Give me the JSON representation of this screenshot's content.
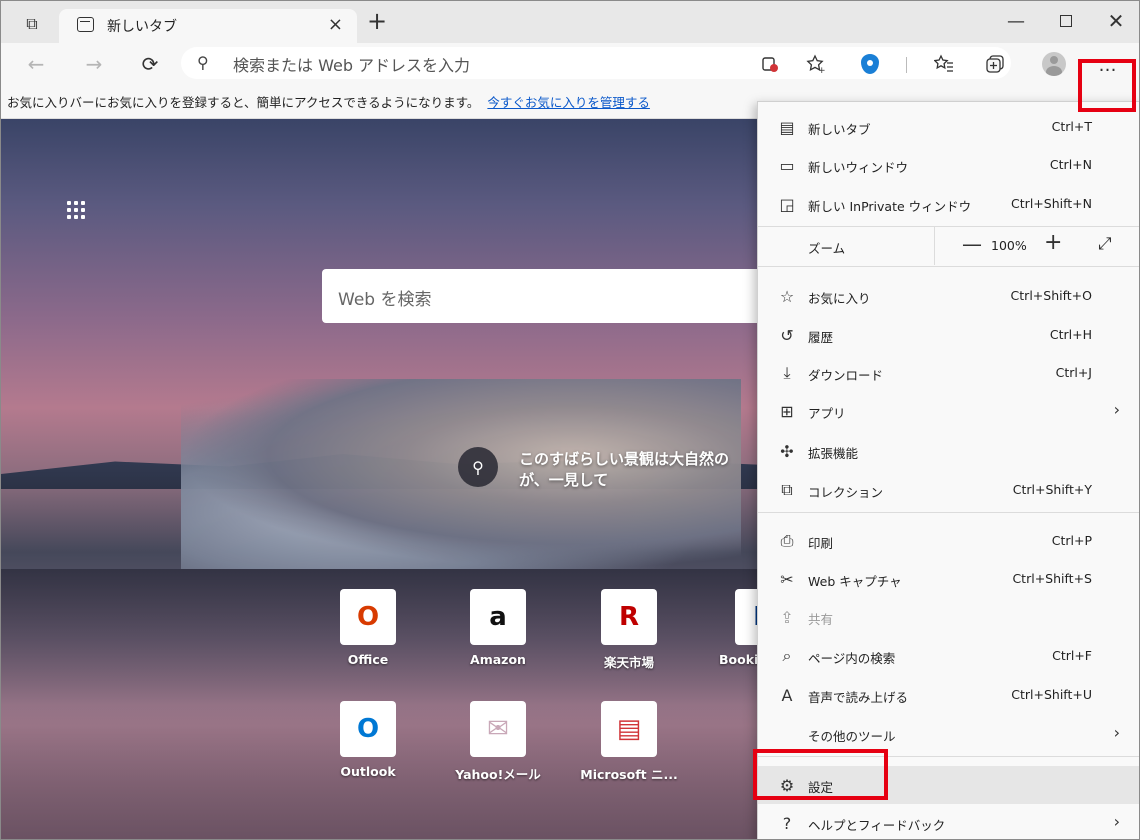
{
  "tab": {
    "title": "新しいタブ",
    "close": "×",
    "new_tab": "+"
  },
  "window": {
    "minimize": "—",
    "close": "✕"
  },
  "toolbar": {
    "back": "←",
    "forward": "→",
    "refresh": "⟳",
    "address_placeholder": "検索または Web アドレスを入力",
    "search_glyph": "⚲",
    "more": "…"
  },
  "favbar": {
    "message": "お気に入りバーにお気に入りを登録すると、簡単にアクセスできるようになります。",
    "link": "今すぐお気に入りを管理する"
  },
  "newtab": {
    "search_placeholder": "Web を検索",
    "caption_line1": "このすばらしい景観は大自然の",
    "caption_line2": "が、一見して",
    "tiles": [
      {
        "label": "Office",
        "glyph": "O",
        "color": "#d83b01"
      },
      {
        "label": "Amazon",
        "glyph": "a",
        "color": "#111111"
      },
      {
        "label": "楽天市場",
        "glyph": "R",
        "color": "#bf0000"
      },
      {
        "label": "Booki",
        "glyph": "B",
        "color": "#003580"
      },
      {
        "label": "Outlook",
        "glyph": "O",
        "color": "#0078d4"
      },
      {
        "label": "Yahoo!メール",
        "glyph": "✉",
        "color": "#c9a8b8"
      },
      {
        "label": "Microsoft ニ...",
        "glyph": "▤",
        "color": "#d13438"
      }
    ]
  },
  "menu": {
    "items": [
      {
        "label": "新しいタブ",
        "shortcut": "Ctrl+T",
        "icon": "new-tab-icon"
      },
      {
        "label": "新しいウィンドウ",
        "shortcut": "Ctrl+N",
        "icon": "new-window-icon"
      },
      {
        "label": "新しい InPrivate ウィンドウ",
        "shortcut": "Ctrl+Shift+N",
        "icon": "inprivate-icon"
      },
      {
        "label": "お気に入り",
        "shortcut": "Ctrl+Shift+O",
        "icon": "favorites-icon"
      },
      {
        "label": "履歴",
        "shortcut": "Ctrl+H",
        "icon": "history-icon"
      },
      {
        "label": "ダウンロード",
        "shortcut": "Ctrl+J",
        "icon": "download-icon"
      },
      {
        "label": "アプリ",
        "shortcut": "",
        "icon": "apps-icon"
      },
      {
        "label": "拡張機能",
        "shortcut": "",
        "icon": "extensions-icon"
      },
      {
        "label": "コレクション",
        "shortcut": "Ctrl+Shift+Y",
        "icon": "collections-icon"
      },
      {
        "label": "印刷",
        "shortcut": "Ctrl+P",
        "icon": "print-icon"
      },
      {
        "label": "Web キャプチャ",
        "shortcut": "Ctrl+Shift+S",
        "icon": "web-capture-icon"
      },
      {
        "label": "共有",
        "shortcut": "",
        "icon": "share-icon"
      },
      {
        "label": "ページ内の検索",
        "shortcut": "Ctrl+F",
        "icon": "find-icon"
      },
      {
        "label": "音声で読み上げる",
        "shortcut": "Ctrl+Shift+U",
        "icon": "read-aloud-icon"
      },
      {
        "label": "その他のツール",
        "shortcut": "",
        "icon": ""
      },
      {
        "label": "設定",
        "shortcut": "",
        "icon": "settings-icon"
      },
      {
        "label": "ヘルプとフィードバック",
        "shortcut": "",
        "icon": "help-icon"
      }
    ],
    "zoom": {
      "label": "ズーム",
      "value": "100%",
      "minus": "—",
      "plus": "+",
      "fullscreen": "⤢"
    },
    "arrow": "›"
  },
  "colors": {
    "accent": "#0a58ca",
    "annotation": "#e60012"
  }
}
